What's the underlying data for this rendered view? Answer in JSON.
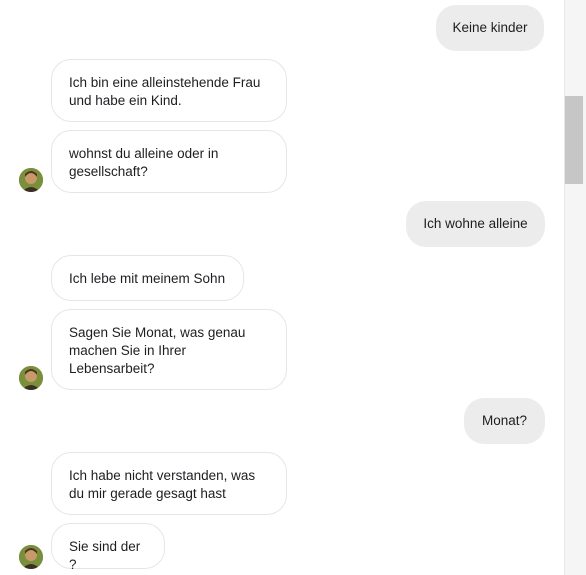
{
  "messages": [
    {
      "dir": "out",
      "text": "Keine kinder"
    },
    {
      "dir": "in",
      "text": "Ich bin eine alleinstehende Frau und habe ein Kind."
    },
    {
      "dir": "in",
      "text": "wohnst du alleine oder in gesellschaft?"
    },
    {
      "dir": "out",
      "text": "Ich wohne alleine"
    },
    {
      "dir": "in",
      "text": "Ich lebe mit meinem Sohn"
    },
    {
      "dir": "in",
      "text": "Sagen Sie Monat, was genau machen Sie in Ihrer Lebensarbeit?"
    },
    {
      "dir": "out",
      "text": "Monat?"
    },
    {
      "dir": "in",
      "text": "Ich habe nicht verstanden, was du mir gerade gesagt hast"
    },
    {
      "dir": "in",
      "text": "Sie sind der ?"
    }
  ],
  "avatar": {
    "icon": "contact-avatar-icon"
  },
  "colors": {
    "incoming_bg": "#ffffff",
    "outgoing_bg": "#ececec",
    "border": "#e6e6e6"
  }
}
